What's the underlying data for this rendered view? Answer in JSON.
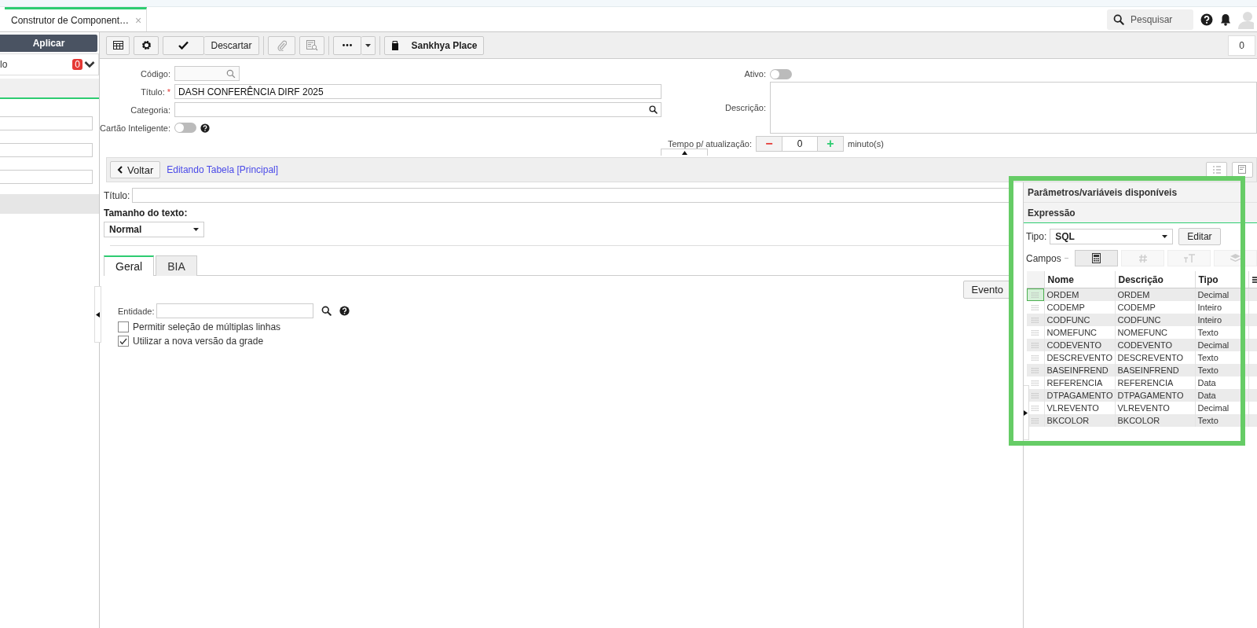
{
  "tab": {
    "title": "Construtor de Component…",
    "close": "×"
  },
  "search": {
    "placeholder": "Pesquisar"
  },
  "left_panel": {
    "apply_button": "Aplicar",
    "filter_label": "lo",
    "badge": "0"
  },
  "toolbar": {
    "discard": "Descartar",
    "place": "Sankhya Place",
    "counter": "0"
  },
  "form": {
    "codigo_label": "Código:",
    "titulo_label": "Título:",
    "required": "*",
    "titulo_value": "DASH CONFERÊNCIA DIRF 2025",
    "categoria_label": "Categoria:",
    "smart_card_label": "Cartão Inteligente:",
    "smart_card_on": false,
    "ativo_label": "Ativo:",
    "ativo_on": false,
    "descricao_label": "Descrição:",
    "tempo_label": "Tempo p/ atualização:",
    "minus": "−",
    "tempo_value": "0",
    "plus": "+",
    "unit": "minuto(s)"
  },
  "edit_bar": {
    "back": "Voltar",
    "context": "Editando Tabela [Principal]"
  },
  "editor": {
    "titulo_label": "Título:",
    "size_label": "Tamanho do texto:",
    "size_value": "Normal",
    "tabs": [
      {
        "label": "Geral",
        "selected": true
      },
      {
        "label": "BIA",
        "selected": false
      }
    ],
    "event_button": "Evento",
    "entity_label": "Entidade:",
    "options": [
      {
        "label": "Permitir seleção de múltiplas linhas",
        "checked": false
      },
      {
        "label": "Utilizar a nova versão da grade",
        "checked": true
      }
    ]
  },
  "right_panel": {
    "title": "Parâmetros/variáveis disponíveis",
    "section": "Expressão",
    "tipo_label": "Tipo:",
    "tipo_value": "SQL",
    "edit_button": "Editar",
    "campos_label": "Campos",
    "field_tools": [
      {
        "kind": "calculator",
        "selected": true
      },
      {
        "kind": "hash",
        "selected": false
      },
      {
        "kind": "text-size",
        "selected": false
      },
      {
        "kind": "layers",
        "selected": false
      }
    ],
    "table": {
      "columns": [
        "Nome",
        "Descrição",
        "Tipo"
      ],
      "rows": [
        {
          "selected": true,
          "cells": [
            "ORDEM",
            "ORDEM",
            "Decimal"
          ]
        },
        {
          "selected": false,
          "cells": [
            "CODEMP",
            "CODEMP",
            "Inteiro"
          ]
        },
        {
          "selected": false,
          "cells": [
            "CODFUNC",
            "CODFUNC",
            "Inteiro"
          ]
        },
        {
          "selected": false,
          "cells": [
            "NOMEFUNC",
            "NOMEFUNC",
            "Texto"
          ]
        },
        {
          "selected": false,
          "cells": [
            "CODEVENTO",
            "CODEVENTO",
            "Decimal"
          ]
        },
        {
          "selected": false,
          "cells": [
            "DESCREVENTO",
            "DESCREVENTO",
            "Texto"
          ]
        },
        {
          "selected": false,
          "cells": [
            "BASEINFREND",
            "BASEINFREND",
            "Texto"
          ]
        },
        {
          "selected": false,
          "cells": [
            "REFERENCIA",
            "REFERENCIA",
            "Data"
          ]
        },
        {
          "selected": false,
          "cells": [
            "DTPAGAMENTO",
            "DTPAGAMENTO",
            "Data"
          ]
        },
        {
          "selected": false,
          "cells": [
            "VLREVENTO",
            "VLREVENTO",
            "Decimal"
          ]
        },
        {
          "selected": false,
          "cells": [
            "BKCOLOR",
            "BKCOLOR",
            "Texto"
          ]
        }
      ]
    }
  }
}
